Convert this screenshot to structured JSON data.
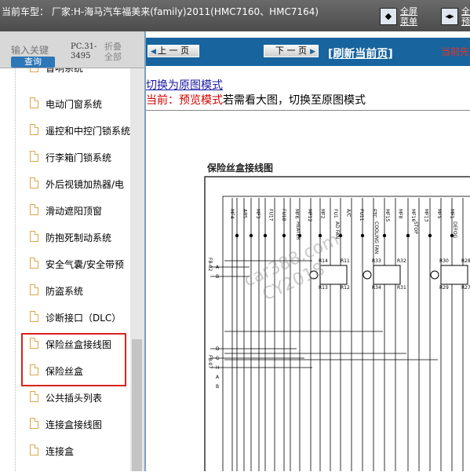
{
  "topbar": {
    "car_info": "当前车型： 厂家:H-海马汽车福美来(family)2011(HMC7160、HMC7164)",
    "fullscreen_menu": "全屏\n菜单",
    "second_btn": "全屏\n预览"
  },
  "left": {
    "search_placeholder": "输入关键",
    "query_label": "查询",
    "pc_code": "PC.31-\n3495",
    "collapse_all": "折叠\n全部",
    "items": [
      {
        "label": "音响系统"
      },
      {
        "label": "电动门窗系统"
      },
      {
        "label": "遥控和中控门锁系统"
      },
      {
        "label": "行李箱门锁系统"
      },
      {
        "label": "外后视镜加热器/电"
      },
      {
        "label": "滑动遮阳顶窗"
      },
      {
        "label": "防抱死制动系统"
      },
      {
        "label": "安全气囊/安全带预"
      },
      {
        "label": "防盗系统"
      },
      {
        "label": "诊断接口（DLC）"
      },
      {
        "label": "保险丝盒接线图"
      },
      {
        "label": "保险丝盒"
      },
      {
        "label": "公共插头列表"
      },
      {
        "label": "连接盒接线图"
      },
      {
        "label": "连接盒"
      }
    ]
  },
  "right": {
    "prev_page": "上 一 页",
    "next_page": "下 一 页",
    "refresh": "[刷新当前页]",
    "current_label": "当前先",
    "switch_link": "切换为原图模式",
    "mode_prefix": "当前：预览模式",
    "mode_suffix": "若需看大图，切换至原图模式",
    "diagram_title": "保险丝盒接线图",
    "watermark": "car388.com\n  CY2018"
  },
  "diagram_labels": {
    "fuses": [
      "MF4",
      "ABS",
      "MF3",
      "FU17",
      "FU18",
      "MF6",
      "MF12",
      "MF2",
      "FU1",
      "A/C",
      "FU11",
      "ETC",
      "MF15",
      "MF8",
      "MF16",
      "MF13",
      "MF5",
      "MF1"
    ],
    "relays": [
      "R14",
      "R11",
      "R13",
      "R12",
      "R33",
      "R32",
      "R34",
      "R31",
      "R30",
      "R28",
      "R29",
      "R27"
    ],
    "connectors": [
      "FB-02",
      "FB-07"
    ],
    "pins": [
      "A",
      "B",
      "D",
      "G",
      "H",
      "A",
      "B"
    ],
    "misc": [
      "HEATER",
      "AD FAN",
      "COOLING FAN",
      "STOP",
      "DEFOG"
    ]
  }
}
